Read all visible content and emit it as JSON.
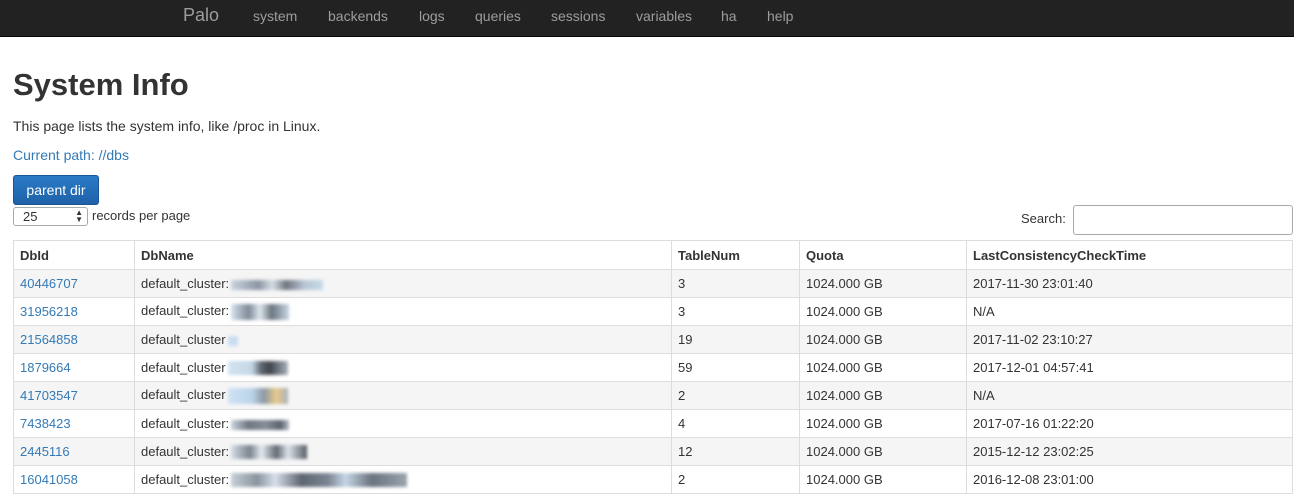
{
  "nav": {
    "brand": "Palo",
    "items": [
      "system",
      "backends",
      "logs",
      "queries",
      "sessions",
      "variables",
      "ha",
      "help"
    ]
  },
  "page": {
    "title": "System Info",
    "description": "This page lists the system info, like /proc in Linux.",
    "current_path": "Current path: //dbs",
    "parent_button": "parent dir",
    "page_size": "25",
    "records_label": "records per page",
    "search_label": "Search:",
    "search_value": ""
  },
  "table": {
    "columns": [
      "DbId",
      "DbName",
      "TableNum",
      "Quota",
      "LastConsistencyCheckTime"
    ],
    "rows": [
      {
        "db_id": "40446707",
        "db_name": "default_cluster:",
        "table_num": "3",
        "quota": "1024.000 GB",
        "last_check": "2017-11-30 23:01:40"
      },
      {
        "db_id": "31956218",
        "db_name": "default_cluster:",
        "table_num": "3",
        "quota": "1024.000 GB",
        "last_check": "N/A"
      },
      {
        "db_id": "21564858",
        "db_name": "default_cluster",
        "table_num": "19",
        "quota": "1024.000 GB",
        "last_check": "2017-11-02 23:10:27"
      },
      {
        "db_id": "1879664",
        "db_name": "default_cluster",
        "table_num": "59",
        "quota": "1024.000 GB",
        "last_check": "2017-12-01 04:57:41"
      },
      {
        "db_id": "41703547",
        "db_name": "default_cluster",
        "table_num": "2",
        "quota": "1024.000 GB",
        "last_check": "N/A"
      },
      {
        "db_id": "7438423",
        "db_name": "default_cluster:",
        "table_num": "4",
        "quota": "1024.000 GB",
        "last_check": "2017-07-16 01:22:20"
      },
      {
        "db_id": "2445116",
        "db_name": "default_cluster:",
        "table_num": "12",
        "quota": "1024.000 GB",
        "last_check": "2015-12-12 23:02:25"
      },
      {
        "db_id": "16041058",
        "db_name": "default_cluster:",
        "table_num": "2",
        "quota": "1024.000 GB",
        "last_check": "2016-12-08 23:01:00"
      }
    ]
  },
  "colors": {
    "navbar_bg": "#222222",
    "nav_text": "#9d9d9d",
    "link": "#337ab7",
    "button": "#2a7ac7",
    "row_stripe": "#f5f5f5"
  }
}
